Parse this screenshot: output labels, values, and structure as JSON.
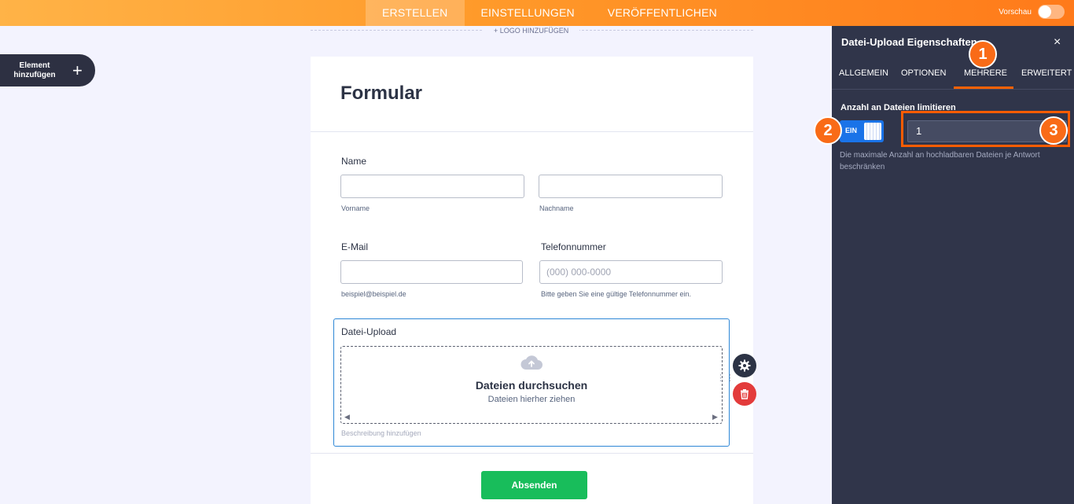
{
  "topbar": {
    "tabs": [
      {
        "label": "ERSTELLEN",
        "active": true
      },
      {
        "label": "EINSTELLUNGEN",
        "active": false
      },
      {
        "label": "VERÖFFENTLICHEN",
        "active": false
      }
    ],
    "preview_label": "Vorschau",
    "preview_on": false
  },
  "sidebar": {
    "add_element_label": "Element hinzufügen",
    "add_icon": "+"
  },
  "canvas": {
    "logo_add_label": "+ LOGO HINZUFÜGEN"
  },
  "form": {
    "title": "Formular",
    "name": {
      "label": "Name",
      "first_sublabel": "Vorname",
      "last_sublabel": "Nachname"
    },
    "email": {
      "label": "E-Mail",
      "sublabel": "beispiel@beispiel.de"
    },
    "phone": {
      "label": "Telefonnummer",
      "placeholder": "(000) 000-0000",
      "sublabel": "Bitte geben Sie eine gültige Telefonnummer ein."
    },
    "upload": {
      "label": "Datei-Upload",
      "browse": "Dateien durchsuchen",
      "drag_here": "Dateien hierher ziehen",
      "description_placeholder": "Beschreibung hinzufügen"
    },
    "submit_label": "Absenden"
  },
  "panel": {
    "title": "Datei-Upload Eigenschaften",
    "close_icon": "×",
    "tabs": [
      {
        "label": "ALLGEMEIN",
        "active": false
      },
      {
        "label": "OPTIONEN",
        "active": false
      },
      {
        "label": "MEHRERE",
        "active": true
      },
      {
        "label": "ERWEITERT",
        "active": false
      }
    ],
    "limit_label": "Anzahl an Dateien limitieren",
    "toggle_label": "EIN",
    "limit_value": "1",
    "limit_hint": "Die maximale Anzahl an hochladbaren Dateien je Antwort beschränken"
  },
  "markers": [
    "1",
    "2",
    "3"
  ],
  "colors": {
    "accent": "#ff6100",
    "panel_bg": "#30354a",
    "submit": "#18bd5b",
    "toggle_on": "#1a73e8",
    "delete": "#e33b3b"
  }
}
